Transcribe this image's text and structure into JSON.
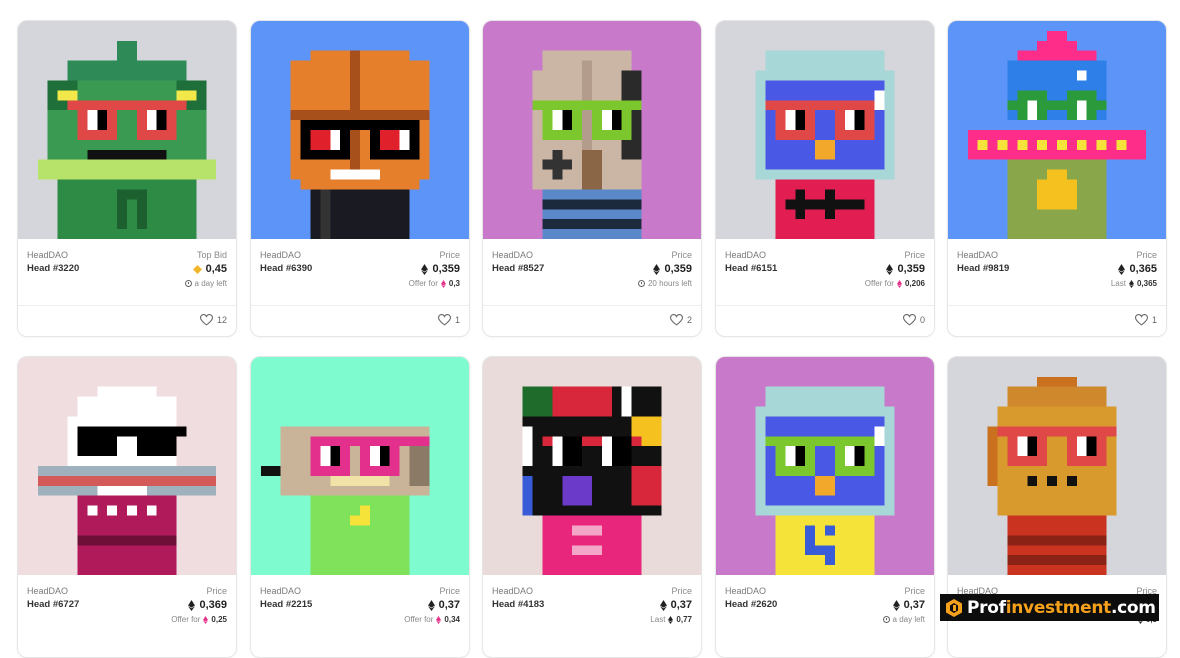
{
  "cards": [
    {
      "collection": "HeadDAO",
      "name": "Head #3220",
      "price_label": "Top Bid",
      "price": "0,45",
      "currency": "weth",
      "sub_prefix": "",
      "sub_value": "a day left",
      "sub_icon": "clock",
      "likes": "12",
      "bg": "#d4d6db"
    },
    {
      "collection": "HeadDAO",
      "name": "Head #6390",
      "price_label": "Price",
      "price": "0,359",
      "currency": "eth",
      "sub_prefix": "Offer for",
      "sub_value": "0,3",
      "sub_icon": "eth-pink",
      "likes": "1",
      "bg": "#5c95f7"
    },
    {
      "collection": "HeadDAO",
      "name": "Head #8527",
      "price_label": "Price",
      "price": "0,359",
      "currency": "eth",
      "sub_prefix": "",
      "sub_value": "20 hours left",
      "sub_icon": "clock",
      "likes": "2",
      "bg": "#c979c9"
    },
    {
      "collection": "HeadDAO",
      "name": "Head #6151",
      "price_label": "Price",
      "price": "0,359",
      "currency": "eth",
      "sub_prefix": "Offer for",
      "sub_value": "0,206",
      "sub_icon": "eth-pink",
      "likes": "0",
      "bg": "#d4d6db"
    },
    {
      "collection": "HeadDAO",
      "name": "Head #9819",
      "price_label": "Price",
      "price": "0,365",
      "currency": "eth",
      "sub_prefix": "Last",
      "sub_value": "0,365",
      "sub_icon": "eth",
      "likes": "1",
      "bg": "#5c95f7"
    },
    {
      "collection": "HeadDAO",
      "name": "Head #6727",
      "price_label": "Price",
      "price": "0,369",
      "currency": "eth",
      "sub_prefix": "Offer for",
      "sub_value": "0,25",
      "sub_icon": "eth-pink",
      "likes": "",
      "bg": "#f0dde0"
    },
    {
      "collection": "HeadDAO",
      "name": "Head #2215",
      "price_label": "Price",
      "price": "0,37",
      "currency": "eth",
      "sub_prefix": "Offer for",
      "sub_value": "0,34",
      "sub_icon": "eth-pink",
      "likes": "",
      "bg": "#7efccf"
    },
    {
      "collection": "HeadDAO",
      "name": "Head #4183",
      "price_label": "Price",
      "price": "0,37",
      "currency": "eth",
      "sub_prefix": "Last",
      "sub_value": "0,77",
      "sub_icon": "eth",
      "likes": "",
      "bg": "#e8dbd9"
    },
    {
      "collection": "HeadDAO",
      "name": "Head #2620",
      "price_label": "Price",
      "price": "0,37",
      "currency": "eth",
      "sub_prefix": "",
      "sub_value": "a day left",
      "sub_icon": "clock",
      "likes": "",
      "bg": "#c979c9"
    },
    {
      "collection": "HeadDAO",
      "name": "",
      "price_label": "Price",
      "price": "",
      "currency": "eth",
      "sub_prefix": "",
      "sub_value": "0,3",
      "sub_icon": "eth",
      "likes": "",
      "bg": "#d4d6db"
    }
  ],
  "watermark": {
    "part1": "Prof",
    "part2": "investment",
    "part3": ".com"
  },
  "colors": {
    "accent": "#f6a11c",
    "pink_eth": "#e6318a"
  }
}
